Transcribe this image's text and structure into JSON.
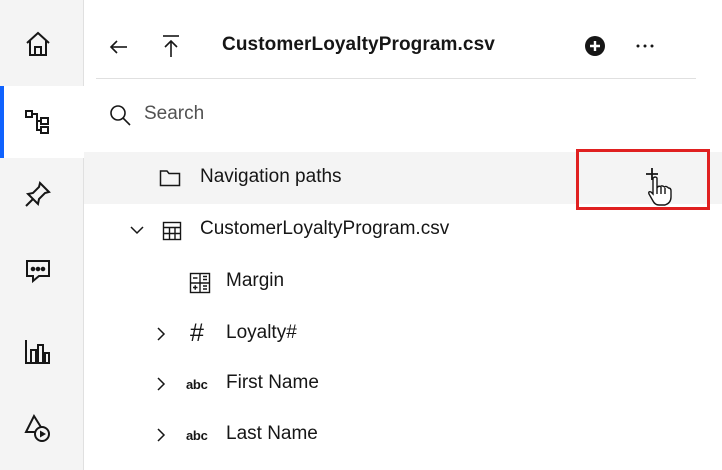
{
  "rail": {
    "items": [
      {
        "name": "home",
        "icon": "home-icon",
        "active": false
      },
      {
        "name": "data",
        "icon": "data-tree-icon",
        "active": true
      },
      {
        "name": "pin",
        "icon": "pin-icon",
        "active": false
      },
      {
        "name": "chat",
        "icon": "chat-icon",
        "active": false
      },
      {
        "name": "visualizations",
        "icon": "bar-chart-icon",
        "active": false
      },
      {
        "name": "shapes",
        "icon": "shapes-icon",
        "active": false
      }
    ]
  },
  "header": {
    "title": "CustomerLoyaltyProgram.csv",
    "back_icon": "arrow-left-icon",
    "up_icon": "arrow-up-to-top-icon",
    "add_icon": "add-filled-icon",
    "overflow_icon": "overflow-menu-icon"
  },
  "search": {
    "placeholder": "Search"
  },
  "tree": {
    "items": [
      {
        "label": "Navigation paths",
        "icon": "folder-icon",
        "highlighted": true
      },
      {
        "label": "CustomerLoyaltyProgram.csv",
        "icon": "table-icon",
        "expanded": true
      },
      {
        "label": "Margin",
        "icon": "calculation-icon"
      },
      {
        "label": "Loyalty#",
        "icon": "hash-icon",
        "glyph": "#",
        "expanded": false
      },
      {
        "label": "First Name",
        "icon": "text-type-icon",
        "glyph": "abc",
        "expanded": false
      },
      {
        "label": "Last Name",
        "icon": "text-type-icon",
        "glyph": "abc",
        "expanded": false
      }
    ]
  },
  "highlight": {
    "color": "#e02020",
    "target_icon": "add-icon",
    "cursor": "hand-pointer-icon"
  },
  "colors": {
    "accent": "#0f62fe",
    "rail_bg": "#f4f4f4",
    "row_highlight": "#f4f4f4"
  }
}
